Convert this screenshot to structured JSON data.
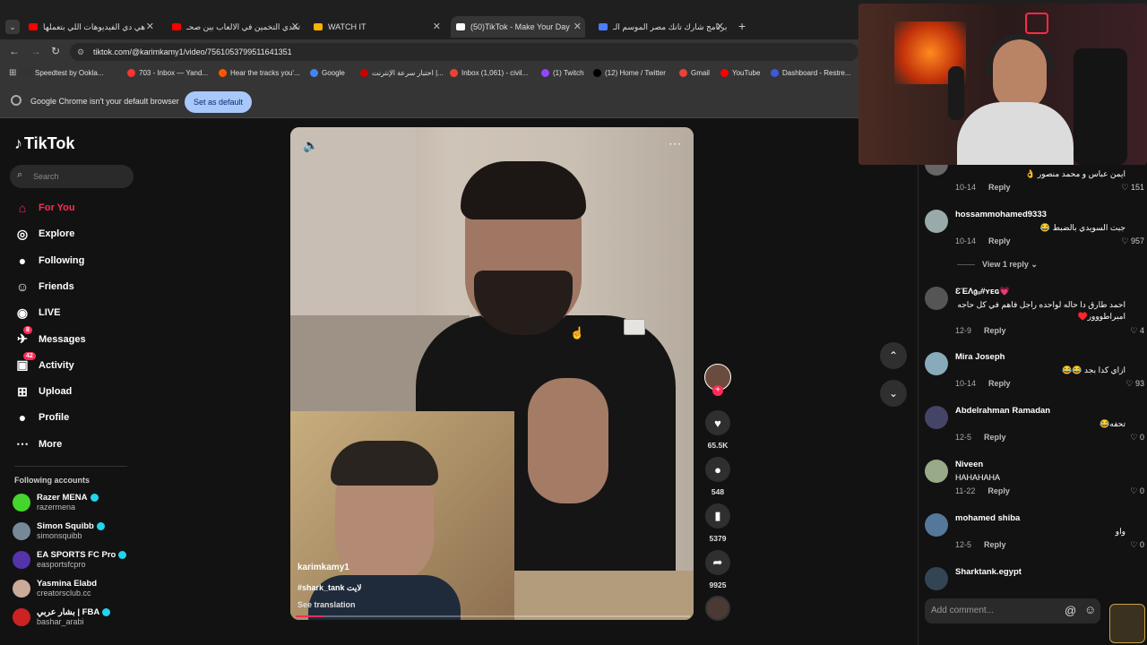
{
  "browser": {
    "tabs": [
      {
        "title": "هي دي الفيديوهات اللي بتعملها",
        "color": "#ff0000"
      },
      {
        "title": "تحدي التخمين في الالعاب بين صحـ",
        "color": "#ff0000"
      },
      {
        "title": "WATCH IT",
        "color": "#f6b400"
      },
      {
        "title": "(50)TikTok - Make Your Day",
        "color": "#ffffff"
      },
      {
        "title": "برنامج شارك تانك مصر الموسم الـ",
        "color": "#4d7cff"
      }
    ],
    "new_tab_icon": "+",
    "url": "tiktok.com/@karimkamy1/video/7561053799511641351",
    "bookmarks": [
      {
        "label": "Speedtest by Ookla...",
        "color": "#333"
      },
      {
        "label": "703 - Inbox — Yand...",
        "color": "#ff3333"
      },
      {
        "label": "Hear the tracks you'...",
        "color": "#ff5500"
      },
      {
        "label": "Google",
        "color": "#4285f4"
      },
      {
        "label": "اختبار سرعة الإنترنت |...",
        "color": "#c00"
      },
      {
        "label": "Inbox (1,061) - civil...",
        "color": "#ea4335"
      },
      {
        "label": "(1) Twitch",
        "color": "#9146ff"
      },
      {
        "label": "(12) Home / Twitter",
        "color": "#000"
      },
      {
        "label": "Gmail",
        "color": "#ea4335"
      },
      {
        "label": "YouTube",
        "color": "#ff0000"
      },
      {
        "label": "Dashboard - Restre...",
        "color": "#3b5bdb"
      }
    ],
    "infobar_text": "Google Chrome isn't your default browser",
    "set_default_label": "Set as default"
  },
  "sidebar": {
    "logo": "TikTok",
    "search_placeholder": "Search",
    "nav": [
      {
        "label": "For You",
        "icon": "home-icon",
        "glyph": "⌂",
        "active": true
      },
      {
        "label": "Explore",
        "icon": "compass-icon",
        "glyph": "◎",
        "active": false
      },
      {
        "label": "Following",
        "icon": "following-icon",
        "glyph": "●",
        "active": false
      },
      {
        "label": "Friends",
        "icon": "friends-icon",
        "glyph": "☺",
        "active": false
      },
      {
        "label": "LIVE",
        "icon": "live-icon",
        "glyph": "◉",
        "active": false
      },
      {
        "label": "Messages",
        "icon": "messages-icon",
        "glyph": "✈",
        "active": false,
        "badge": "8"
      },
      {
        "label": "Activity",
        "icon": "activity-icon",
        "glyph": "▣",
        "active": false,
        "badge": "42"
      },
      {
        "label": "Upload",
        "icon": "upload-icon",
        "glyph": "⊞",
        "active": false
      },
      {
        "label": "Profile",
        "icon": "profile-icon",
        "glyph": "●",
        "active": false
      },
      {
        "label": "More",
        "icon": "more-icon",
        "glyph": "⋯",
        "active": false
      }
    ],
    "following_title": "Following accounts",
    "accounts": [
      {
        "name": "Razer MENA",
        "user": "razermena",
        "color": "#44d62c",
        "verified": true
      },
      {
        "name": "Simon Squibb",
        "user": "simonsquibb",
        "color": "#778899",
        "verified": true
      },
      {
        "name": "EA SPORTS FC Pro",
        "user": "easportsfcpro",
        "color": "#5533aa",
        "verified": true
      },
      {
        "name": "Yasmina Elabd",
        "user": "creatorsclub.cc",
        "color": "#ccaa99",
        "verified": false
      },
      {
        "name": "بشار عربي | FBA",
        "user": "bashar_arabi",
        "color": "#cc2222",
        "verified": true
      }
    ]
  },
  "video": {
    "author": "karimkamy1",
    "caption": "#shark_tank لايت",
    "see_translation": "See translation",
    "likes": "65.5K",
    "comments": "548",
    "saves": "5379",
    "shares": "9925"
  },
  "comments": [
    {
      "user": "",
      "text": "ايمن عباس و محمد منصور 👌",
      "date": "10-14",
      "reply": "Reply",
      "likes": "151",
      "color": "#666"
    },
    {
      "user": "hossammohamed9333",
      "text": "جبت السويدي بالضبط 😂",
      "date": "10-14",
      "reply": "Reply",
      "likes": "957",
      "color": "#9aa"
    },
    {
      "user": "ƐΈΛ𝔤ᵤ#ʏᴇɢ💗",
      "text": "احمد طارق دا حاله لواحده راجل فاهم في كل حاجه امبراطووور♥️",
      "date": "12-9",
      "reply": "Reply",
      "likes": "4",
      "color": "#555"
    },
    {
      "user": "Mira Joseph",
      "text": "ازاي كدا بجد 😂😂",
      "date": "10-14",
      "reply": "Reply",
      "likes": "93",
      "color": "#8ab"
    },
    {
      "user": "Abdelrahman Ramadan",
      "text": "تحفه😂",
      "date": "12-5",
      "reply": "Reply",
      "likes": "0",
      "color": "#446"
    },
    {
      "user": "Niveen",
      "text": "HAHAHAHA",
      "date": "11-22",
      "reply": "Reply",
      "likes": "0",
      "color": "#9a8"
    },
    {
      "user": "mohamed shiba",
      "text": "واو",
      "date": "12-5",
      "reply": "Reply",
      "likes": "0",
      "color": "#579"
    },
    {
      "user": "Sharktank.egypt",
      "text": "",
      "date": "",
      "reply": "",
      "likes": "",
      "color": "#345"
    }
  ],
  "view_replies": "View 1 reply",
  "add_comment_placeholder": "Add comment..."
}
